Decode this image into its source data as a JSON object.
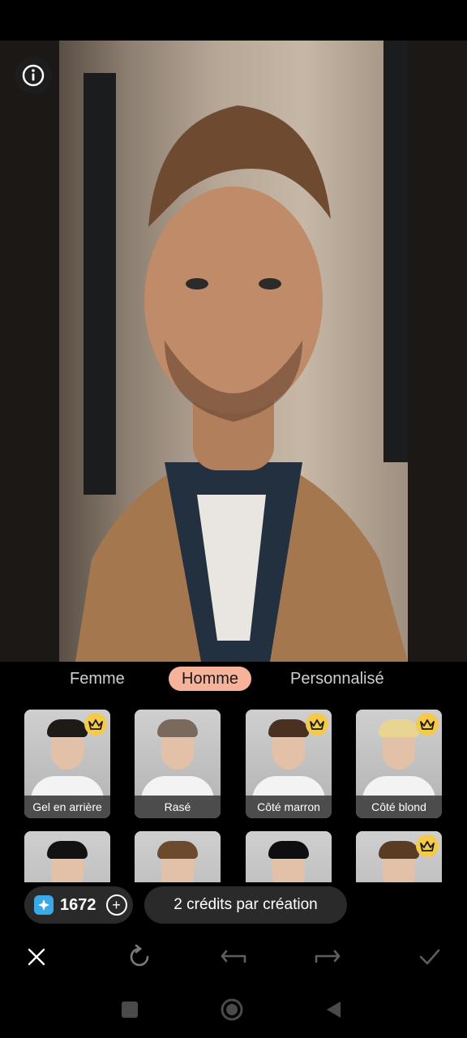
{
  "tabs": [
    {
      "label": "Femme"
    },
    {
      "label": "Homme"
    },
    {
      "label": "Personnalisé"
    }
  ],
  "active_tab": "Homme",
  "styles": [
    {
      "label": "Gel en arrière",
      "premium": true,
      "hair_color": "#1d1a18"
    },
    {
      "label": "Rasé",
      "premium": false,
      "hair_color": "#7a6a5e"
    },
    {
      "label": "Côté marron",
      "premium": true,
      "hair_color": "#4a3020"
    },
    {
      "label": "Côté blond",
      "premium": true,
      "hair_color": "#e8d493"
    },
    {
      "label": "",
      "premium": false,
      "hair_color": "#121212"
    },
    {
      "label": "",
      "premium": false,
      "hair_color": "#6b4a2d"
    },
    {
      "label": "",
      "premium": false,
      "hair_color": "#0e0e10"
    },
    {
      "label": "",
      "premium": true,
      "hair_color": "#5a3c24"
    }
  ],
  "credits": {
    "count": "1672"
  },
  "tooltip": "2 crédits par création",
  "icons": {
    "info": "info-icon",
    "close": "close-icon",
    "reset": "reset-icon",
    "undo": "undo-icon",
    "redo": "redo-icon",
    "confirm": "check-icon",
    "plus": "plus-icon",
    "gem": "gem-icon",
    "crown": "crown-icon"
  },
  "colors": {
    "accent": "#f6b39a",
    "crown": "#f5c94a",
    "gem": "#3ba9e8"
  }
}
